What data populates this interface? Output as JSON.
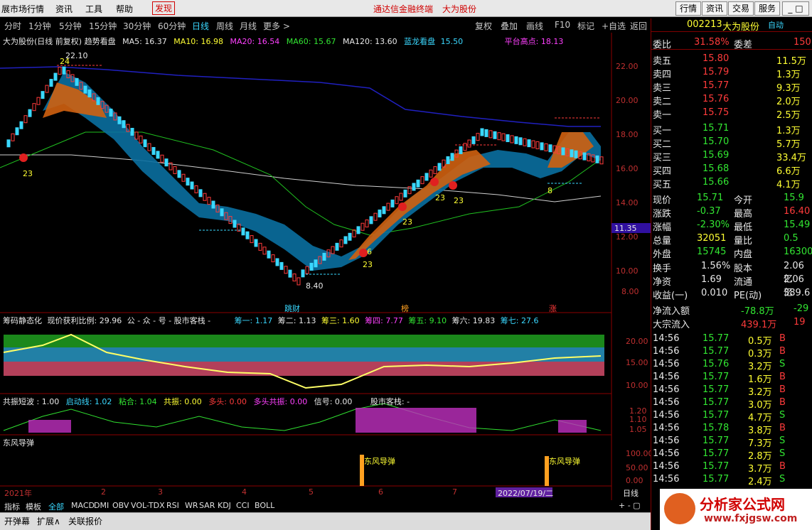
{
  "menubar": {
    "items": [
      "展市场行情",
      "资讯",
      "工具",
      "帮助"
    ],
    "alert": "发现",
    "center1": "通达信金融终端",
    "center2": "大为股份",
    "right": [
      "行情",
      "资讯",
      "交易",
      "服务"
    ]
  },
  "periods": [
    "分时",
    "1分钟",
    "5分钟",
    "15分钟",
    "30分钟",
    "60分钟",
    "日线",
    "周线",
    "月线",
    "更多 >"
  ],
  "tools": [
    "复权",
    "叠加",
    "画线",
    "F10",
    "标记",
    "+自选",
    "返回"
  ],
  "header": {
    "name": "大为股份(日线 前复权) 趋势看盘",
    "ma5": "MA5: 16.37",
    "ma10": "MA10: 16.98",
    "ma20": "MA20: 16.54",
    "ma60": "MA60: 15.67",
    "ma120": "MA120: 13.60",
    "blue_dragon": "蓝龙看盘",
    "blue_val": "15.50",
    "platform": "平台高点: 18.13"
  },
  "price_axis": [
    "22.00",
    "20.00",
    "18.00",
    "16.00",
    "14.00",
    "12.00",
    "10.00",
    "8.00"
  ],
  "price_tag": "11.35",
  "annotations": {
    "high": "22.10",
    "low": "8.40",
    "n23": "23",
    "n6": "6",
    "n8": "8",
    "n24": "24",
    "b1": "跳财",
    "b2": "榜",
    "b3": "涨"
  },
  "chips": {
    "title": "筹码静态化",
    "profit": "现价获利比例: 29.96",
    "a": "公 - 众 - 号 - 股市客栈 -",
    "c1": "筹一: 1.17",
    "c2": "筹二: 1.13",
    "c3": "筹三: 1.60",
    "c4": "筹四: 7.77",
    "c5": "筹五: 9.10",
    "c6": "筹六: 19.83",
    "c7": "筹七: 27.6",
    "axis": [
      "20.00",
      "15.00",
      "10.00"
    ]
  },
  "osc": {
    "title": "共振短波 : 1.00",
    "s1": "启动线: 1.02",
    "s2": "粘合: 1.04",
    "s3": "共振: 0.00",
    "s4": "多头: 0.00",
    "s5": "多头共振: 0.00",
    "s6": "信号: 0.00",
    "s7": "股市客栈: -",
    "axis": [
      "1.20",
      "1.10",
      "1.05"
    ]
  },
  "missile": {
    "title": "东风导弹",
    "label1": "东风导弹",
    "label2": "东风导弹",
    "axis": [
      "100.00",
      "50.00",
      "0.00"
    ]
  },
  "timeaxis": {
    "y2021": "2021年",
    "m2": "2",
    "m3": "3",
    "m4": "4",
    "m5": "5",
    "m6": "6",
    "m7": "7",
    "date": "2022/07/19/二",
    "period": "日线"
  },
  "indicators": [
    "指标",
    "模板",
    "全部",
    "MACD",
    "DMI",
    "OBV",
    "VOL-TDX",
    "RSI",
    "WR",
    "SAR",
    "KDJ",
    "CCI",
    "BOLL"
  ],
  "status": [
    "开弹幕",
    "扩展∧",
    "关联报价"
  ],
  "stock": {
    "code": "002213",
    "name": "大为股份",
    "auto": "自动",
    "weibi_label": "委比",
    "weibi": "31.58%",
    "weicha_label": "委差",
    "weicha": "150"
  },
  "asks": [
    {
      "l": "卖五",
      "p": "15.80",
      "v": "11.5万"
    },
    {
      "l": "卖四",
      "p": "15.79",
      "v": "1.3万"
    },
    {
      "l": "卖三",
      "p": "15.77",
      "v": "9.3万"
    },
    {
      "l": "卖二",
      "p": "15.76",
      "v": "2.0万"
    },
    {
      "l": "卖一",
      "p": "15.75",
      "v": "2.5万"
    }
  ],
  "bids": [
    {
      "l": "买一",
      "p": "15.71",
      "v": "1.3万"
    },
    {
      "l": "买二",
      "p": "15.70",
      "v": "5.7万"
    },
    {
      "l": "买三",
      "p": "15.69",
      "v": "33.4万"
    },
    {
      "l": "买四",
      "p": "15.68",
      "v": "6.6万"
    },
    {
      "l": "买五",
      "p": "15.66",
      "v": "4.1万"
    }
  ],
  "quote": [
    {
      "a": "现价",
      "av": "15.71",
      "b": "今开",
      "bv": "15.9"
    },
    {
      "a": "涨跌",
      "av": "-0.37",
      "b": "最高",
      "bv": "16.40"
    },
    {
      "a": "涨幅",
      "av": "-2.30%",
      "b": "最低",
      "bv": "15.49"
    },
    {
      "a": "总量",
      "av": "32051",
      "b": "量比",
      "bv": "0.5"
    },
    {
      "a": "外盘",
      "av": "15745",
      "b": "内盘",
      "bv": "16300"
    }
  ],
  "quote2": [
    {
      "a": "换手",
      "av": "1.56%",
      "b": "股本",
      "bv": "2.06亿"
    },
    {
      "a": "净资",
      "av": "1.69",
      "b": "流通",
      "bv": "2.06亿"
    },
    {
      "a": "收益(一)",
      "av": "0.010",
      "b": "PE(动)",
      "bv": "389.6"
    }
  ],
  "flow": [
    {
      "a": "净流入额",
      "v1": "-78.8万",
      "v2": "-29"
    },
    {
      "a": "大宗流入",
      "v1": "439.1万",
      "v2": "19"
    }
  ],
  "trades": [
    {
      "t": "14:56",
      "p": "15.77",
      "v": "0.5万",
      "s": "B"
    },
    {
      "t": "14:56",
      "p": "15.77",
      "v": "0.3万",
      "s": "B"
    },
    {
      "t": "14:56",
      "p": "15.76",
      "v": "3.2万",
      "s": "S"
    },
    {
      "t": "14:56",
      "p": "15.77",
      "v": "1.6万",
      "s": "B"
    },
    {
      "t": "14:56",
      "p": "15.77",
      "v": "3.2万",
      "s": "B"
    },
    {
      "t": "14:56",
      "p": "15.77",
      "v": "3.0万",
      "s": "B"
    },
    {
      "t": "14:56",
      "p": "15.77",
      "v": "4.7万",
      "s": "S"
    },
    {
      "t": "14:56",
      "p": "15.78",
      "v": "3.8万",
      "s": "B"
    },
    {
      "t": "14:56",
      "p": "15.77",
      "v": "7.3万",
      "s": "S"
    },
    {
      "t": "14:56",
      "p": "15.77",
      "v": "2.8万",
      "s": "S"
    },
    {
      "t": "14:56",
      "p": "15.77",
      "v": "3.7万",
      "s": "B"
    },
    {
      "t": "14:56",
      "p": "15.77",
      "v": "2.4万",
      "s": "S"
    }
  ],
  "logo": {
    "text": "分析家公式网",
    "url": "www.fxjgsw.com"
  },
  "colors": {
    "up": "#ff3b3b",
    "down": "#32e632",
    "ma5": "#ffffff",
    "ma10": "#ffff33",
    "ma20": "#ff40ff",
    "ma60": "#32e632"
  }
}
